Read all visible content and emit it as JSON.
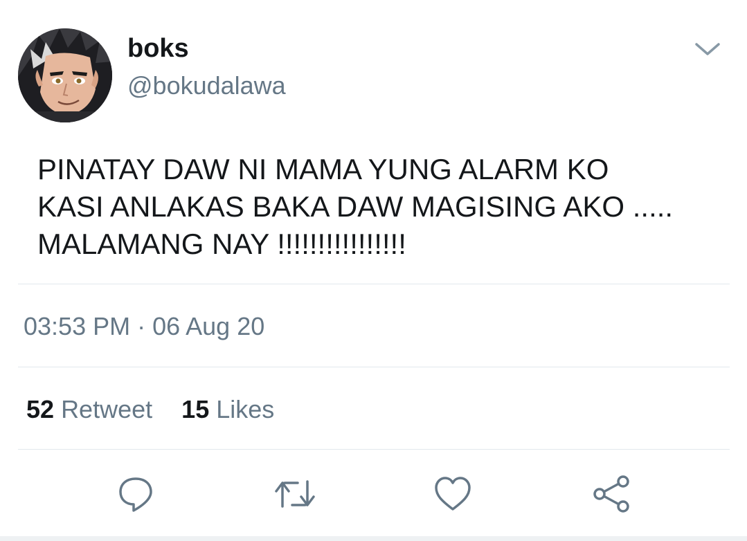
{
  "user": {
    "display_name": "boks",
    "handle": "@bokudalawa",
    "avatar_icon": "anime-avatar-icon"
  },
  "tweet": {
    "text": "PINATAY DAW NI MAMA YUNG ALARM KO\nKASI ANLAKAS BAKA DAW MAGISING AKO .....\nMALAMANG NAY !!!!!!!!!!!!!!!!",
    "timestamp": "03:53 PM · 06 Aug 20"
  },
  "stats": {
    "retweet_count": "52",
    "retweet_label": "Retweet",
    "likes_count": "15",
    "likes_label": "Likes"
  },
  "actions": [
    {
      "icon": "reply-icon"
    },
    {
      "icon": "retweet-icon"
    },
    {
      "icon": "like-icon"
    },
    {
      "icon": "share-icon"
    }
  ],
  "colors": {
    "primary_text": "#14171a",
    "secondary_text": "#657786",
    "divider": "#e1e8ed",
    "icon": "#657786"
  }
}
